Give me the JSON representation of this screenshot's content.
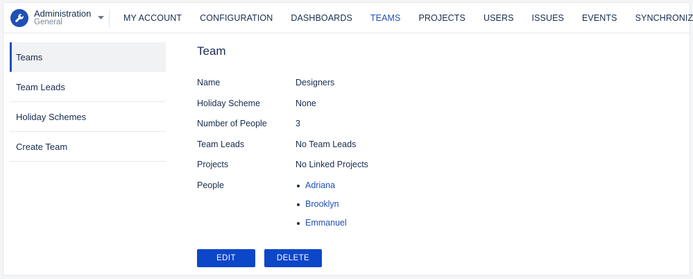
{
  "app": {
    "title": "Administration",
    "subtitle": "General"
  },
  "nav": {
    "items": [
      {
        "label": "MY ACCOUNT"
      },
      {
        "label": "CONFIGURATION"
      },
      {
        "label": "DASHBOARDS"
      },
      {
        "label": "TEAMS",
        "active": true
      },
      {
        "label": "PROJECTS"
      },
      {
        "label": "USERS"
      },
      {
        "label": "ISSUES"
      },
      {
        "label": "EVENTS"
      },
      {
        "label": "SYNCHRONIZATION"
      }
    ]
  },
  "sidebar": {
    "items": [
      {
        "label": "Teams",
        "active": true
      },
      {
        "label": "Team Leads"
      },
      {
        "label": "Holiday Schemes"
      },
      {
        "label": "Create Team"
      }
    ]
  },
  "team": {
    "title": "Team",
    "fields": {
      "name": {
        "label": "Name",
        "value": "Designers"
      },
      "holiday_scheme": {
        "label": "Holiday Scheme",
        "value": "None"
      },
      "number_of_people": {
        "label": "Number of People",
        "value": "3"
      },
      "team_leads": {
        "label": "Team Leads",
        "value": "No Team Leads"
      },
      "projects": {
        "label": "Projects",
        "value": "No Linked Projects"
      },
      "people": {
        "label": "People",
        "members": [
          "Adriana",
          "Brooklyn",
          "Emmanuel"
        ]
      }
    }
  },
  "actions": {
    "edit_label": "EDIT",
    "delete_label": "DELETE"
  },
  "colors": {
    "accent": "#1f4fb7",
    "button": "#0c47c9",
    "text": "#172b4d",
    "muted": "#7a869a"
  },
  "icons": {
    "app": "wrench-icon",
    "app_menu": "chevron-down-icon"
  }
}
